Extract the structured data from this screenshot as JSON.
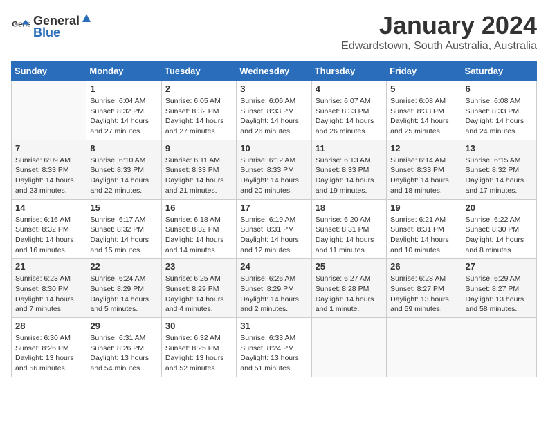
{
  "header": {
    "logo_general": "General",
    "logo_blue": "Blue",
    "title": "January 2024",
    "subtitle": "Edwardstown, South Australia, Australia"
  },
  "days_of_week": [
    "Sunday",
    "Monday",
    "Tuesday",
    "Wednesday",
    "Thursday",
    "Friday",
    "Saturday"
  ],
  "weeks": [
    [
      {
        "day": "",
        "info": ""
      },
      {
        "day": "1",
        "info": "Sunrise: 6:04 AM\nSunset: 8:32 PM\nDaylight: 14 hours\nand 27 minutes."
      },
      {
        "day": "2",
        "info": "Sunrise: 6:05 AM\nSunset: 8:32 PM\nDaylight: 14 hours\nand 27 minutes."
      },
      {
        "day": "3",
        "info": "Sunrise: 6:06 AM\nSunset: 8:33 PM\nDaylight: 14 hours\nand 26 minutes."
      },
      {
        "day": "4",
        "info": "Sunrise: 6:07 AM\nSunset: 8:33 PM\nDaylight: 14 hours\nand 26 minutes."
      },
      {
        "day": "5",
        "info": "Sunrise: 6:08 AM\nSunset: 8:33 PM\nDaylight: 14 hours\nand 25 minutes."
      },
      {
        "day": "6",
        "info": "Sunrise: 6:08 AM\nSunset: 8:33 PM\nDaylight: 14 hours\nand 24 minutes."
      }
    ],
    [
      {
        "day": "7",
        "info": "Sunrise: 6:09 AM\nSunset: 8:33 PM\nDaylight: 14 hours\nand 23 minutes."
      },
      {
        "day": "8",
        "info": "Sunrise: 6:10 AM\nSunset: 8:33 PM\nDaylight: 14 hours\nand 22 minutes."
      },
      {
        "day": "9",
        "info": "Sunrise: 6:11 AM\nSunset: 8:33 PM\nDaylight: 14 hours\nand 21 minutes."
      },
      {
        "day": "10",
        "info": "Sunrise: 6:12 AM\nSunset: 8:33 PM\nDaylight: 14 hours\nand 20 minutes."
      },
      {
        "day": "11",
        "info": "Sunrise: 6:13 AM\nSunset: 8:33 PM\nDaylight: 14 hours\nand 19 minutes."
      },
      {
        "day": "12",
        "info": "Sunrise: 6:14 AM\nSunset: 8:33 PM\nDaylight: 14 hours\nand 18 minutes."
      },
      {
        "day": "13",
        "info": "Sunrise: 6:15 AM\nSunset: 8:32 PM\nDaylight: 14 hours\nand 17 minutes."
      }
    ],
    [
      {
        "day": "14",
        "info": "Sunrise: 6:16 AM\nSunset: 8:32 PM\nDaylight: 14 hours\nand 16 minutes."
      },
      {
        "day": "15",
        "info": "Sunrise: 6:17 AM\nSunset: 8:32 PM\nDaylight: 14 hours\nand 15 minutes."
      },
      {
        "day": "16",
        "info": "Sunrise: 6:18 AM\nSunset: 8:32 PM\nDaylight: 14 hours\nand 14 minutes."
      },
      {
        "day": "17",
        "info": "Sunrise: 6:19 AM\nSunset: 8:31 PM\nDaylight: 14 hours\nand 12 minutes."
      },
      {
        "day": "18",
        "info": "Sunrise: 6:20 AM\nSunset: 8:31 PM\nDaylight: 14 hours\nand 11 minutes."
      },
      {
        "day": "19",
        "info": "Sunrise: 6:21 AM\nSunset: 8:31 PM\nDaylight: 14 hours\nand 10 minutes."
      },
      {
        "day": "20",
        "info": "Sunrise: 6:22 AM\nSunset: 8:30 PM\nDaylight: 14 hours\nand 8 minutes."
      }
    ],
    [
      {
        "day": "21",
        "info": "Sunrise: 6:23 AM\nSunset: 8:30 PM\nDaylight: 14 hours\nand 7 minutes."
      },
      {
        "day": "22",
        "info": "Sunrise: 6:24 AM\nSunset: 8:29 PM\nDaylight: 14 hours\nand 5 minutes."
      },
      {
        "day": "23",
        "info": "Sunrise: 6:25 AM\nSunset: 8:29 PM\nDaylight: 14 hours\nand 4 minutes."
      },
      {
        "day": "24",
        "info": "Sunrise: 6:26 AM\nSunset: 8:29 PM\nDaylight: 14 hours\nand 2 minutes."
      },
      {
        "day": "25",
        "info": "Sunrise: 6:27 AM\nSunset: 8:28 PM\nDaylight: 14 hours\nand 1 minute."
      },
      {
        "day": "26",
        "info": "Sunrise: 6:28 AM\nSunset: 8:27 PM\nDaylight: 13 hours\nand 59 minutes."
      },
      {
        "day": "27",
        "info": "Sunrise: 6:29 AM\nSunset: 8:27 PM\nDaylight: 13 hours\nand 58 minutes."
      }
    ],
    [
      {
        "day": "28",
        "info": "Sunrise: 6:30 AM\nSunset: 8:26 PM\nDaylight: 13 hours\nand 56 minutes."
      },
      {
        "day": "29",
        "info": "Sunrise: 6:31 AM\nSunset: 8:26 PM\nDaylight: 13 hours\nand 54 minutes."
      },
      {
        "day": "30",
        "info": "Sunrise: 6:32 AM\nSunset: 8:25 PM\nDaylight: 13 hours\nand 52 minutes."
      },
      {
        "day": "31",
        "info": "Sunrise: 6:33 AM\nSunset: 8:24 PM\nDaylight: 13 hours\nand 51 minutes."
      },
      {
        "day": "",
        "info": ""
      },
      {
        "day": "",
        "info": ""
      },
      {
        "day": "",
        "info": ""
      }
    ]
  ]
}
